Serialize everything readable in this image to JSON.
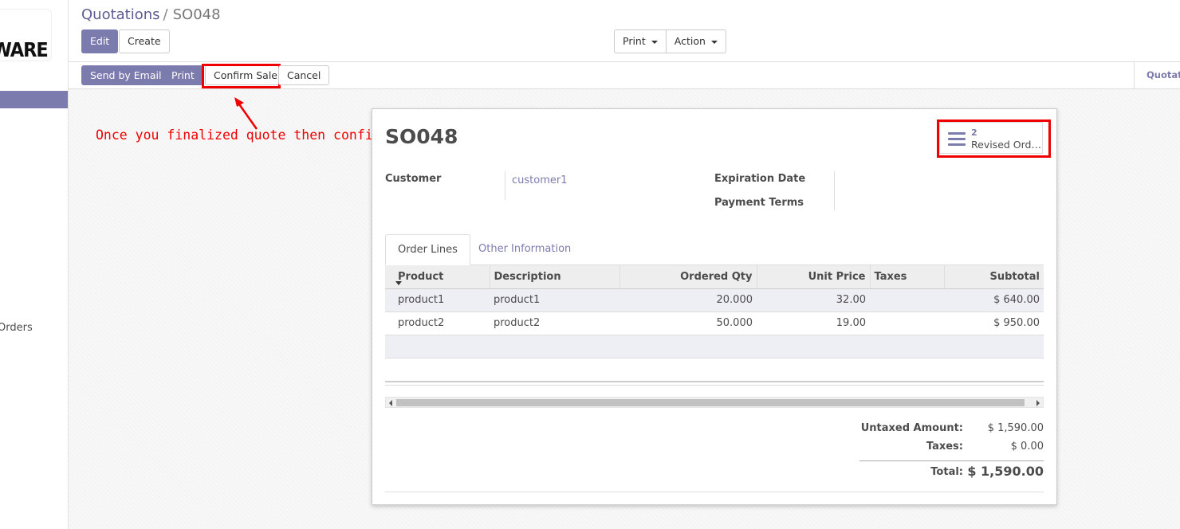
{
  "sidebar": {
    "logo_line1": "/",
    "logo_line2": "WARE",
    "orders_label": "Orders"
  },
  "header": {
    "breadcrumb_parent": "Quotations",
    "breadcrumb_sep": "/",
    "breadcrumb_current": "SO048",
    "edit_label": "Edit",
    "create_label": "Create",
    "print_label": "Print",
    "action_label": "Action"
  },
  "statusbar": {
    "send_email_label": "Send by Email",
    "print_label": "Print",
    "confirm_label": "Confirm Sale",
    "cancel_label": "Cancel",
    "stage_label": "Quotation"
  },
  "annotation": {
    "text": "Once you finalized quote then confirm it",
    "color": "#ee0000"
  },
  "form": {
    "title": "SO048",
    "smart_button": {
      "count": "2",
      "label": "Revised Orders"
    },
    "customer_label": "Customer",
    "customer_value": "customer1",
    "expiration_label": "Expiration Date",
    "payment_terms_label": "Payment Terms",
    "tabs": [
      {
        "label": "Order Lines"
      },
      {
        "label": "Other Information"
      }
    ],
    "columns": {
      "product": "Product",
      "description": "Description",
      "ordered_qty": "Ordered Qty",
      "unit_price": "Unit Price",
      "taxes": "Taxes",
      "subtotal": "Subtotal"
    },
    "lines": [
      {
        "product": "product1",
        "description": "product1",
        "qty": "20.000",
        "price": "32.00",
        "taxes": "",
        "subtotal": "$ 640.00"
      },
      {
        "product": "product2",
        "description": "product2",
        "qty": "50.000",
        "price": "19.00",
        "taxes": "",
        "subtotal": "$ 950.00"
      }
    ],
    "totals": {
      "untaxed_label": "Untaxed Amount:",
      "untaxed_value": "$ 1,590.00",
      "taxes_label": "Taxes:",
      "taxes_value": "$ 0.00",
      "total_label": "Total:",
      "total_value": "$ 1,590.00"
    }
  },
  "colors": {
    "accent": "#7c7bad",
    "highlight": "#ee0000"
  }
}
